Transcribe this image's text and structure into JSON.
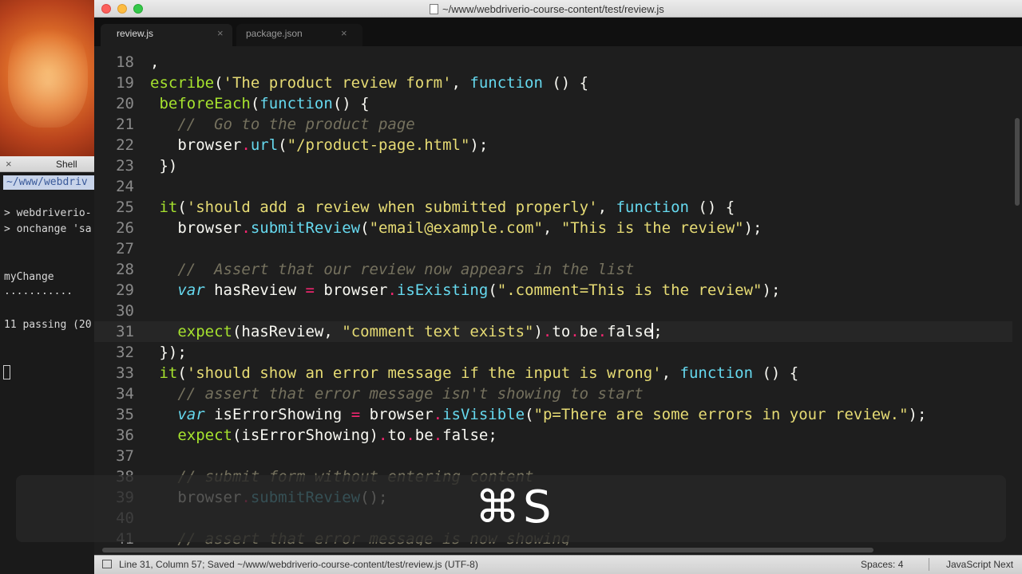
{
  "window": {
    "title": "~/www/webdriverio-course-content/test/review.js"
  },
  "tabs": [
    {
      "label": "review.js",
      "close": "×",
      "active": true
    },
    {
      "label": "package.json",
      "close": "×",
      "active": false
    }
  ],
  "shell": {
    "title": "Shell",
    "close": "×",
    "path": "~/www/webdriv",
    "lines": [
      "> webdriverio-",
      "> onchange 'sa",
      "myChange",
      "...........",
      "11 passing (20"
    ]
  },
  "editor": {
    "lines": [
      {
        "n": "18",
        "segments": [
          {
            "t": ",",
            "c": "r"
          }
        ]
      },
      {
        "n": "19",
        "segments": [
          {
            "t": "escribe",
            "c": "f"
          },
          {
            "t": "(",
            "c": "r"
          },
          {
            "t": "'The product review form'",
            "c": "s"
          },
          {
            "t": ", ",
            "c": "r"
          },
          {
            "t": "function",
            "c": "p"
          },
          {
            "t": " () {",
            "c": "r"
          }
        ]
      },
      {
        "n": "20",
        "segments": [
          {
            "t": " ",
            "c": "r"
          },
          {
            "t": "beforeEach",
            "c": "f"
          },
          {
            "t": "(",
            "c": "r"
          },
          {
            "t": "function",
            "c": "p"
          },
          {
            "t": "() {",
            "c": "r"
          }
        ]
      },
      {
        "n": "21",
        "segments": [
          {
            "t": "   ",
            "c": "r"
          },
          {
            "t": "//  Go to the product page",
            "c": "c"
          }
        ]
      },
      {
        "n": "22",
        "segments": [
          {
            "t": "   browser",
            "c": "r"
          },
          {
            "t": ".",
            "c": "dot"
          },
          {
            "t": "url",
            "c": "p"
          },
          {
            "t": "(",
            "c": "r"
          },
          {
            "t": "\"/product-page.html\"",
            "c": "s"
          },
          {
            "t": ");",
            "c": "r"
          }
        ]
      },
      {
        "n": "23",
        "segments": [
          {
            "t": " })",
            "c": "r"
          }
        ]
      },
      {
        "n": "24",
        "segments": []
      },
      {
        "n": "25",
        "segments": [
          {
            "t": " ",
            "c": "r"
          },
          {
            "t": "it",
            "c": "f"
          },
          {
            "t": "(",
            "c": "r"
          },
          {
            "t": "'should add a review when submitted properly'",
            "c": "s"
          },
          {
            "t": ", ",
            "c": "r"
          },
          {
            "t": "function",
            "c": "p"
          },
          {
            "t": " () {",
            "c": "r"
          }
        ]
      },
      {
        "n": "26",
        "segments": [
          {
            "t": "   browser",
            "c": "r"
          },
          {
            "t": ".",
            "c": "dot"
          },
          {
            "t": "submitReview",
            "c": "p"
          },
          {
            "t": "(",
            "c": "r"
          },
          {
            "t": "\"email@example.com\"",
            "c": "s"
          },
          {
            "t": ", ",
            "c": "r"
          },
          {
            "t": "\"This is the review\"",
            "c": "s"
          },
          {
            "t": ");",
            "c": "r"
          }
        ]
      },
      {
        "n": "27",
        "segments": []
      },
      {
        "n": "28",
        "segments": [
          {
            "t": "   ",
            "c": "r"
          },
          {
            "t": "//  Assert that our review now appears in the list",
            "c": "c"
          }
        ]
      },
      {
        "n": "29",
        "segments": [
          {
            "t": "   ",
            "c": "r"
          },
          {
            "t": "var",
            "c": "k"
          },
          {
            "t": " hasReview ",
            "c": "r"
          },
          {
            "t": "=",
            "c": "kw"
          },
          {
            "t": " browser",
            "c": "r"
          },
          {
            "t": ".",
            "c": "dot"
          },
          {
            "t": "isExisting",
            "c": "p"
          },
          {
            "t": "(",
            "c": "r"
          },
          {
            "t": "\".comment=This is the review\"",
            "c": "s"
          },
          {
            "t": ");",
            "c": "r"
          }
        ]
      },
      {
        "n": "30",
        "segments": []
      },
      {
        "n": "31",
        "active": true,
        "segments": [
          {
            "t": "   ",
            "c": "r"
          },
          {
            "t": "expect",
            "c": "f"
          },
          {
            "t": "(hasReview, ",
            "c": "r"
          },
          {
            "t": "\"comment text exists\"",
            "c": "s"
          },
          {
            "t": ")",
            "c": "r"
          },
          {
            "t": ".",
            "c": "dot"
          },
          {
            "t": "to",
            "c": "r"
          },
          {
            "t": ".",
            "c": "dot"
          },
          {
            "t": "be",
            "c": "r"
          },
          {
            "t": ".",
            "c": "dot"
          },
          {
            "t": "false",
            "c": "r"
          },
          {
            "t": "|",
            "c": "caret"
          },
          {
            "t": ";",
            "c": "r"
          }
        ]
      },
      {
        "n": "32",
        "segments": [
          {
            "t": " });",
            "c": "r"
          }
        ]
      },
      {
        "n": "33",
        "segments": [
          {
            "t": " ",
            "c": "r"
          },
          {
            "t": "it",
            "c": "f"
          },
          {
            "t": "(",
            "c": "r"
          },
          {
            "t": "'should show an error message if the input is wrong'",
            "c": "s"
          },
          {
            "t": ", ",
            "c": "r"
          },
          {
            "t": "function",
            "c": "p"
          },
          {
            "t": " () {",
            "c": "r"
          }
        ]
      },
      {
        "n": "34",
        "segments": [
          {
            "t": "   ",
            "c": "r"
          },
          {
            "t": "// assert that error message isn't showing to start",
            "c": "c"
          }
        ]
      },
      {
        "n": "35",
        "segments": [
          {
            "t": "   ",
            "c": "r"
          },
          {
            "t": "var",
            "c": "k"
          },
          {
            "t": " isErrorShowing ",
            "c": "r"
          },
          {
            "t": "=",
            "c": "kw"
          },
          {
            "t": " browser",
            "c": "r"
          },
          {
            "t": ".",
            "c": "dot"
          },
          {
            "t": "isVisible",
            "c": "p"
          },
          {
            "t": "(",
            "c": "r"
          },
          {
            "t": "\"p=There are some errors in your review.\"",
            "c": "s"
          },
          {
            "t": ");",
            "c": "r"
          }
        ]
      },
      {
        "n": "36",
        "segments": [
          {
            "t": "   ",
            "c": "r"
          },
          {
            "t": "expect",
            "c": "f"
          },
          {
            "t": "(isErrorShowing)",
            "c": "r"
          },
          {
            "t": ".",
            "c": "dot"
          },
          {
            "t": "to",
            "c": "r"
          },
          {
            "t": ".",
            "c": "dot"
          },
          {
            "t": "be",
            "c": "r"
          },
          {
            "t": ".",
            "c": "dot"
          },
          {
            "t": "false",
            "c": "r"
          },
          {
            "t": ";",
            "c": "r"
          }
        ]
      },
      {
        "n": "37",
        "segments": []
      },
      {
        "n": "38",
        "segments": [
          {
            "t": "   ",
            "c": "r"
          },
          {
            "t": "// submit form without entering content",
            "c": "c"
          }
        ]
      },
      {
        "n": "39",
        "segments": [
          {
            "t": "   browser",
            "c": "r"
          },
          {
            "t": ".",
            "c": "dot"
          },
          {
            "t": "submitReview",
            "c": "p"
          },
          {
            "t": "();",
            "c": "r"
          }
        ]
      },
      {
        "n": "40",
        "segments": []
      },
      {
        "n": "41",
        "segments": [
          {
            "t": "   ",
            "c": "r"
          },
          {
            "t": "// assert that error message is now showing",
            "c": "c"
          }
        ]
      }
    ]
  },
  "statusbar": {
    "text": "Line 31, Column 57; Saved ~/www/webdriverio-course-content/test/review.js (UTF-8)",
    "spaces": "Spaces: 4",
    "language": "JavaScript Next"
  },
  "overlay": {
    "shortcut": "⌘S"
  }
}
